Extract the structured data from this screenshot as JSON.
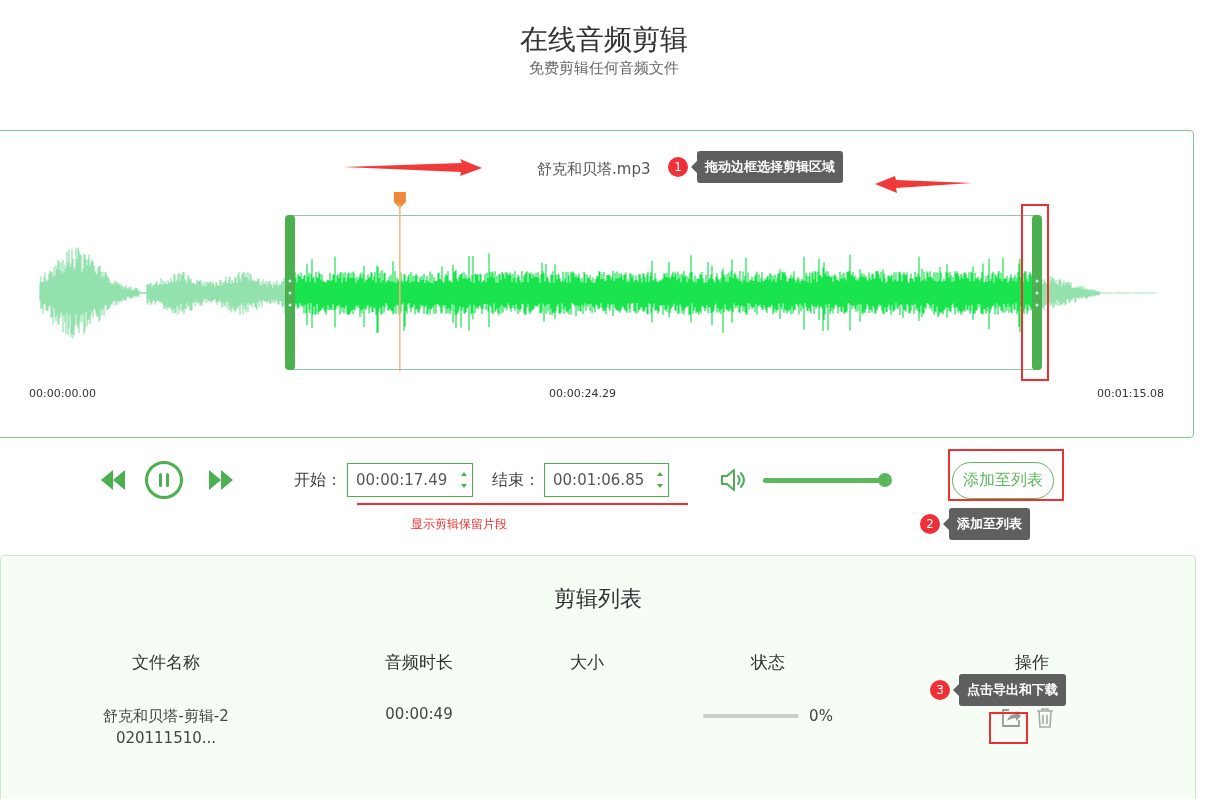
{
  "header": {
    "title": "在线音频剪辑",
    "subtitle": "免费剪辑任何音频文件"
  },
  "editor": {
    "file_name": "舒克和贝塔.mp3",
    "playhead": {
      "level": 0.331
    },
    "time_labels": [
      "00:00:00.00",
      "00:00:24.29",
      "00:01:15.08"
    ]
  },
  "controls": {
    "playing": true,
    "start_label": "开始：",
    "start_value": "00:00:17.49",
    "end_label": "结束：",
    "end_value": "00:01:06.85",
    "volume": {
      "level": 1
    },
    "add_button": "添加至列表"
  },
  "annotations": [
    {
      "number": "1",
      "text": "拖动边框选择剪辑区域"
    },
    {
      "number": "2",
      "text": "添加至列表"
    },
    {
      "number": "3",
      "text": "点击导出和下载"
    }
  ],
  "annotation_note": "显示剪辑保留片段",
  "clip_list": {
    "title": "剪辑列表",
    "columns": [
      "文件名称",
      "音频时长",
      "大小",
      "状态",
      "操作"
    ],
    "rows": [
      {
        "file_name": "舒克和贝塔-剪辑-2020111510...",
        "duration": "00:00:49",
        "progress": {
          "level": 0
        },
        "percent": "0%"
      }
    ]
  }
}
